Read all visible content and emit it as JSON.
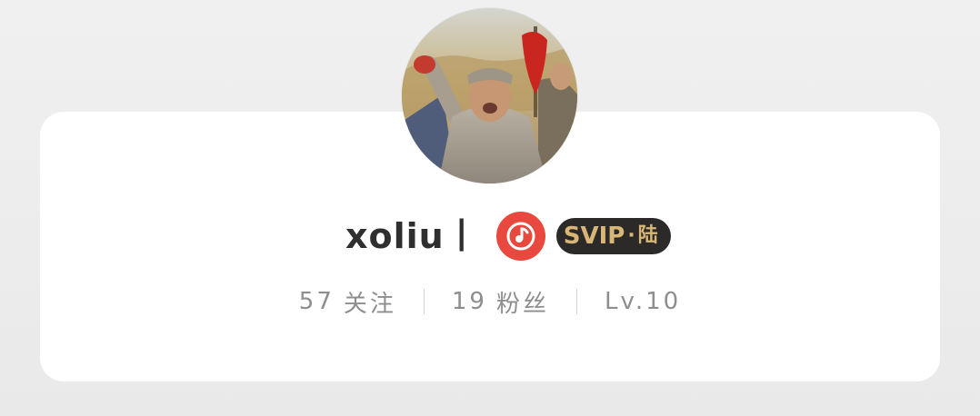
{
  "profile": {
    "username": "xoliu丨",
    "badges": {
      "music_icon": "music-note-icon",
      "svip_main": "SVIP",
      "svip_separator": "·",
      "svip_rank": "陆"
    },
    "stats": {
      "following_count": "57",
      "following_label": "关注",
      "followers_count": "19",
      "followers_label": "粉丝",
      "level_label": "Lv.10"
    }
  },
  "colors": {
    "background": "#eeeded",
    "card": "#ffffff",
    "music_badge": "#e8483d",
    "svip_bg": "#2c2a29",
    "svip_text": "#d8b776",
    "username": "#2f2f2f",
    "stats_text": "#8e8e8e"
  }
}
